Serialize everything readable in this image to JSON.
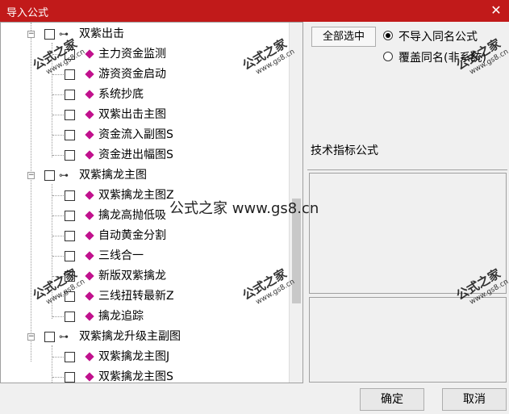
{
  "window": {
    "title": "导入公式",
    "close_glyph": "✕"
  },
  "tree": {
    "groups": [
      {
        "label": "双紫出击",
        "items": [
          "主力资金监测",
          "游资资金启动",
          "系统抄底",
          "双紫出击主图",
          "资金流入副图S",
          "资金进出幅图S"
        ]
      },
      {
        "label": "双紫擒龙主图",
        "items": [
          "双紫擒龙主图Z",
          "擒龙高抛低吸",
          "自动黄金分割",
          "三线合一",
          "新版双紫擒龙",
          "三线扭转最新Z",
          "擒龙追踪"
        ]
      },
      {
        "label": "双紫擒龙升级主副图",
        "items": [
          "双紫擒龙主图J",
          "双紫擒龙主图S"
        ]
      }
    ]
  },
  "right": {
    "select_all": "全部选中",
    "radio_skip": "不导入同名公式",
    "radio_overwrite": "覆盖同名(非系统)",
    "info_label": "技术指标公式"
  },
  "watermark": {
    "text": "公式之家",
    "url": "www.gs8.cn",
    "center": "公式之家 www.gs8.cn"
  },
  "buttons": {
    "ok": "确定",
    "cancel": "取消"
  }
}
